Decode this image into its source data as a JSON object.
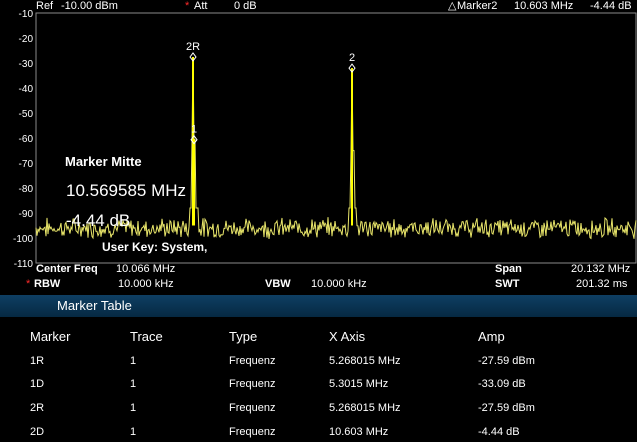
{
  "header": {
    "ref_label": "Ref",
    "ref_value": "-10.00 dBm",
    "att_marker": "*",
    "att_label": "Att",
    "att_value": "0 dB",
    "delta_symbol": "△",
    "active_marker": "Marker2",
    "active_marker_freq": "10.603 MHz",
    "active_marker_amp": "-4.44 dB"
  },
  "y_axis": {
    "ticks": [
      "-10",
      "-20",
      "-30",
      "-40",
      "-50",
      "-60",
      "-70",
      "-80",
      "-90",
      "-100",
      "-110"
    ]
  },
  "markers": [
    {
      "label": "2R",
      "freq_mhz": 5.268015,
      "amp_dbm": -27.59
    },
    {
      "label": "1",
      "freq_mhz": 5.3015,
      "amp_dbm": -60.68
    },
    {
      "label": "2",
      "freq_mhz": 10.603,
      "amp_dbm": -32.03
    }
  ],
  "overlay": {
    "title": "Marker Mitte",
    "freq": "10.569585 MHz",
    "level": "-4.44 dB",
    "user_key": "User Key:  System,"
  },
  "footer": {
    "center_freq_label": "Center Freq",
    "center_freq_value": "10.066 MHz",
    "span_label": "Span",
    "span_value": "20.132 MHz",
    "rbw_star": "*",
    "rbw_label": "RBW",
    "rbw_value": "10.000 kHz",
    "vbw_label": "VBW",
    "vbw_value": "10.000 kHz",
    "swt_label": "SWT",
    "swt_value": "201.32 ms"
  },
  "marker_table": {
    "title": "Marker Table",
    "columns": [
      "Marker",
      "Trace",
      "Type",
      "X Axis",
      "Amp"
    ],
    "rows": [
      [
        "1R",
        "1",
        "Frequenz",
        "5.268015 MHz",
        "-27.59 dBm"
      ],
      [
        "1D",
        "1",
        "Frequenz",
        "5.3015 MHz",
        "-33.09 dB"
      ],
      [
        "2R",
        "1",
        "Frequenz",
        "5.268015 MHz",
        "-27.59 dBm"
      ],
      [
        "2D",
        "1",
        "Frequenz",
        "10.603 MHz",
        "-4.44 dB"
      ]
    ]
  },
  "colors": {
    "trace": "#e9e66a",
    "marker_line": "#ffff00",
    "grid": "#8a8a8a",
    "attention": "#ff2a2a",
    "table_header_bg": "#0a3654"
  }
}
